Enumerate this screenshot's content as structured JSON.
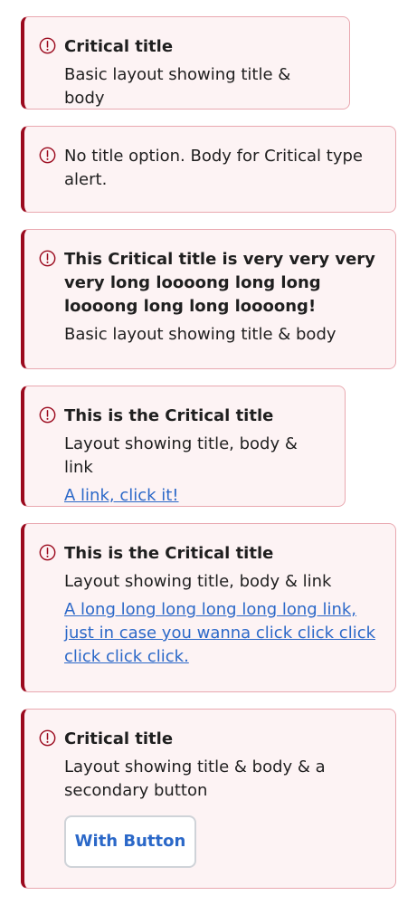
{
  "colors": {
    "critical_accent": "#9b0a1e",
    "alert_background": "#fdf3f4",
    "alert_border": "#e9a8b0",
    "link": "#2b68c8"
  },
  "icon": "alert-circle-icon",
  "alerts": [
    {
      "title": "Critical title",
      "body": "Basic layout showing title & body"
    },
    {
      "body": "No title option. Body for Critical type alert."
    },
    {
      "title": "This Critical title is very very very very long loooong long long loooong long long loooong!",
      "body": "Basic layout showing title & body"
    },
    {
      "title": "This is the Critical title",
      "body": "Layout showing title, body & link",
      "link": "A link, click it!"
    },
    {
      "title": "This is the Critical title",
      "body": "Layout showing title, body & link",
      "link": "A long long long long long long link, just in case you wanna click click click click click click."
    },
    {
      "title": "Critical title",
      "body": "Layout showing title & body & a secondary button",
      "button": "With Button"
    }
  ]
}
